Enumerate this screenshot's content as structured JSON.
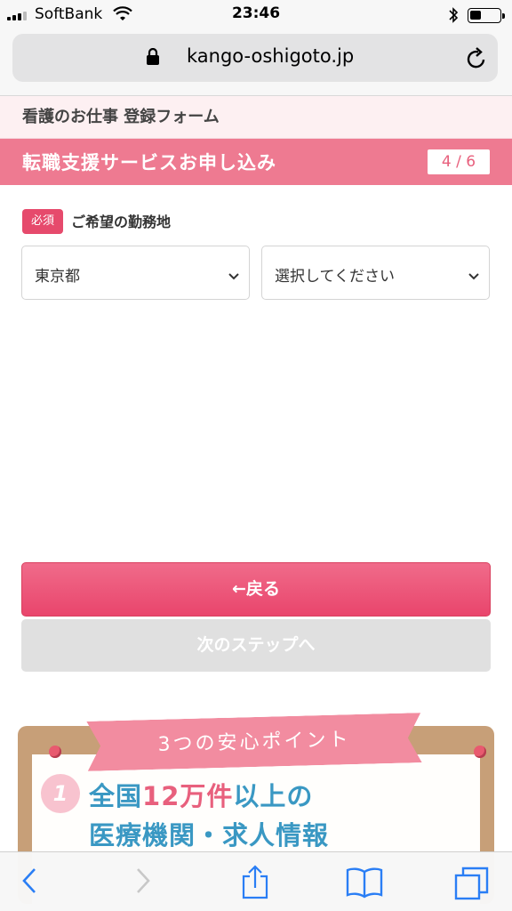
{
  "status_bar": {
    "carrier": "SoftBank",
    "time": "23:46"
  },
  "browser": {
    "url": "kango-oshigoto.jp"
  },
  "form": {
    "title": "看護のお仕事 登録フォーム",
    "step_title": "転職支援サービスお申し込み",
    "step_counter": "4 / 6",
    "required_badge": "必須",
    "field_label": "ご希望の勤務地",
    "prefecture_value": "東京都",
    "city_placeholder": "選択してください",
    "back_button": "←戻る",
    "next_button": "次のステップへ"
  },
  "promo": {
    "ribbon": "3つの安心ポイント",
    "number": "1",
    "line1_pre": "全国",
    "line1_highlight": "12万件",
    "line1_post": "以上の",
    "line2": "医療機関・求人情報"
  },
  "colors": {
    "accent_pink": "#ee7a91",
    "button_pink": "#e9456c",
    "promo_blue": "#3a98c3"
  }
}
